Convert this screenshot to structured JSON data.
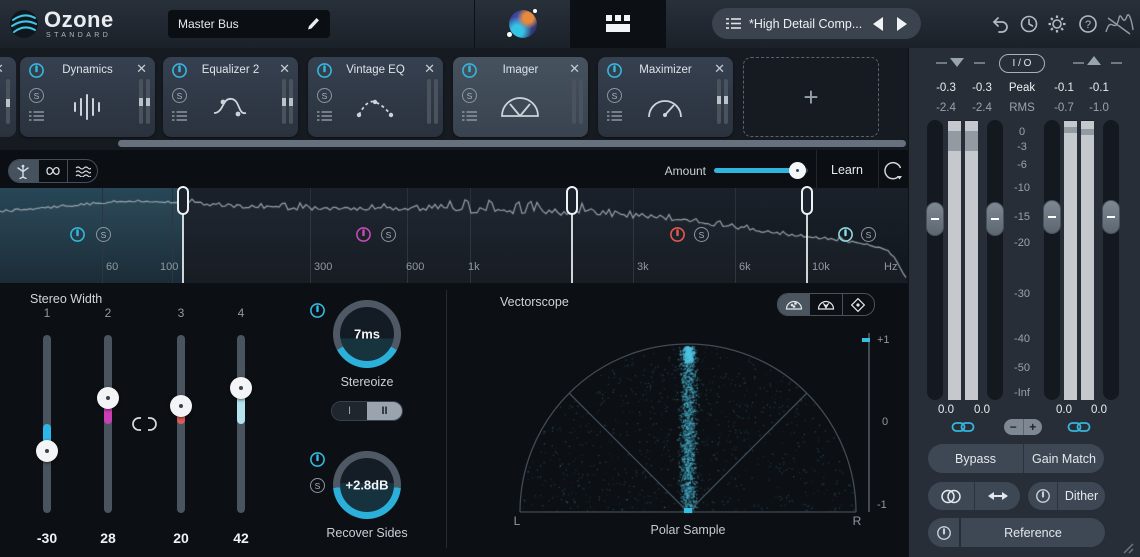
{
  "app": {
    "title": "Ozone",
    "subtitle": "STANDARD"
  },
  "topbar": {
    "preset_name": "Master Bus",
    "preset_selector": "*High Detail Comp..."
  },
  "modules": {
    "items": [
      {
        "name": "Dynamics"
      },
      {
        "name": "Equalizer 2"
      },
      {
        "name": "Vintage EQ"
      },
      {
        "name": "Imager"
      },
      {
        "name": "Maximizer"
      }
    ],
    "add": "+",
    "solo": "S",
    "close": "✕"
  },
  "imager": {
    "amount": "Amount",
    "learn": "Learn",
    "freqs": [
      "60",
      "100",
      "300",
      "600",
      "1k",
      "3k",
      "6k",
      "10k"
    ],
    "unit": "Hz",
    "solo": "S"
  },
  "stereo_width": {
    "title": "Stereo Width",
    "bands": [
      {
        "num": "1",
        "value": "-30"
      },
      {
        "num": "2",
        "value": "28"
      },
      {
        "num": "3",
        "value": "20"
      },
      {
        "num": "4",
        "value": "42"
      }
    ]
  },
  "stereoize": {
    "value": "7ms",
    "label": "Stereoize",
    "mode1": "I",
    "mode2": "II"
  },
  "recover": {
    "value": "+2.8dB",
    "label": "Recover Sides",
    "solo": "S"
  },
  "vectorscope": {
    "title": "Vectorscope",
    "footer": "Polar Sample",
    "left": "L",
    "right": "R",
    "corr": [
      "+1",
      "0",
      "-1"
    ]
  },
  "io": {
    "header": "I / O",
    "peak": "Peak",
    "rms": "RMS",
    "in_peak": [
      "-0.3",
      "-0.3"
    ],
    "in_rms": [
      "-2.4",
      "-2.4"
    ],
    "out_peak": [
      "-0.1",
      "-0.1"
    ],
    "out_rms": [
      "-0.7",
      "-1.0"
    ],
    "scale": [
      "0",
      "-3",
      "-6",
      "-10",
      "-15",
      "-20",
      "-30",
      "-40",
      "-50",
      "-Inf"
    ],
    "fader_values": [
      "0.0",
      "0.0",
      "0.0",
      "0.0"
    ],
    "minus": "−",
    "plus": "+",
    "bypass": "Bypass",
    "gain_match": "Gain Match",
    "dither": "Dither",
    "reference": "Reference"
  },
  "colors": {
    "accent": "#33b6dd",
    "band2": "#c44ab8",
    "band3": "#e15a50",
    "band4": "#8fd8de",
    "meter_fill": "#c5c9cd"
  }
}
